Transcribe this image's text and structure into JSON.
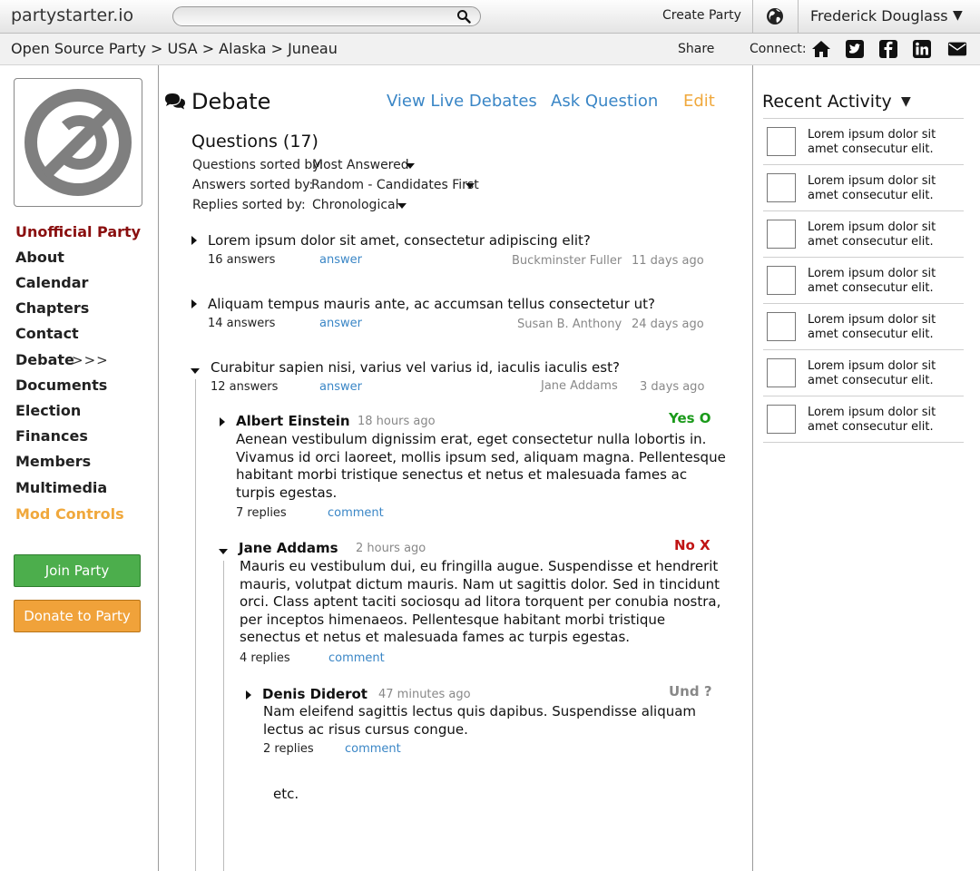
{
  "header": {
    "logo": "partystarter.io",
    "create_party": "Create Party",
    "user_name": "Frederick Douglass",
    "user_caret": "▼"
  },
  "breadcrumb": {
    "text": "Open Source Party > USA > Alaska > Juneau",
    "share": "Share",
    "connect": "Connect:"
  },
  "sidebar": {
    "items": [
      {
        "label": "Unofficial Party"
      },
      {
        "label": "About"
      },
      {
        "label": "Calendar"
      },
      {
        "label": "Chapters"
      },
      {
        "label": "Contact"
      },
      {
        "label": "Debate"
      },
      {
        "label": "Documents"
      },
      {
        "label": "Election"
      },
      {
        "label": "Finances"
      },
      {
        "label": "Members"
      },
      {
        "label": "Multimedia"
      },
      {
        "label": "Mod Controls"
      }
    ],
    "debate_arrow": ">>>",
    "join_button": "Join Party",
    "donate_button": "Donate to Party"
  },
  "main": {
    "title": "Debate",
    "view_live": "View Live Debates",
    "ask_question": "Ask Question",
    "edit": "Edit",
    "questions_heading": "Questions (17)",
    "sort": {
      "questions_label": "Questions sorted by:",
      "questions_value": "Most Answered",
      "answers_label": "Answers sorted by:",
      "answers_value": "Random - Candidates First",
      "replies_label": "Replies sorted by:",
      "replies_value": "Chronological"
    },
    "questions": [
      {
        "text": "Lorem ipsum dolor sit amet, consectetur adipiscing elit?",
        "answers": "16 answers",
        "answer_link": "answer",
        "author": "Buckminster Fuller",
        "time": "11 days ago"
      },
      {
        "text": "Aliquam tempus mauris ante, ac accumsan tellus consectetur ut?",
        "answers": "14 answers",
        "answer_link": "answer",
        "author": "Susan B. Anthony",
        "time": "24 days ago"
      },
      {
        "text": "Curabitur sapien nisi, varius vel varius id, iaculis iaculis est?",
        "answers": "12 answers",
        "answer_link": "answer",
        "author": "Jane Addams",
        "time": "3 days ago"
      }
    ],
    "answers": [
      {
        "author": "Albert Einstein",
        "time": "18 hours ago",
        "vote": "Yes O",
        "lines": [
          "Aenean vestibulum dignissim erat, eget consectetur nulla lobortis in.",
          "Vivamus id orci laoreet, mollis ipsum sed, aliquam magna. Pellentesque",
          "habitant morbi tristique senectus et netus et malesuada fames ac",
          "turpis egestas."
        ],
        "replies": "7 replies",
        "comment": "comment"
      },
      {
        "author": "Jane Addams",
        "time": "2 hours ago",
        "vote": "No X",
        "lines": [
          "Mauris eu vestibulum dui, eu fringilla augue. Suspendisse et hendrerit",
          "mauris, volutpat dictum mauris. Nam ut sagittis dolor. Sed in tincidunt",
          "orci. Class aptent taciti sociosqu ad litora torquent per conubia nostra,",
          "per inceptos himenaeos. Pellentesque habitant morbi tristique",
          "senectus et netus et malesuada fames ac turpis egestas."
        ],
        "replies": "4 replies",
        "comment": "comment"
      }
    ],
    "reply": {
      "author": "Denis Diderot",
      "time": "47 minutes ago",
      "vote": "Und ?",
      "lines": [
        "Nam eleifend sagittis lectus quis dapibus. Suspendisse aliquam",
        "lectus ac risus cursus congue."
      ],
      "replies": "2 replies",
      "comment": "comment"
    },
    "etc": "etc."
  },
  "activity": {
    "title": "Recent Activity",
    "caret": "▼",
    "items": [
      {
        "line1": "Lorem ipsum dolor sit",
        "line2": "amet consecutur elit."
      },
      {
        "line1": "Lorem ipsum dolor sit",
        "line2": "amet consecutur elit."
      },
      {
        "line1": "Lorem ipsum dolor sit",
        "line2": "amet consecutur elit."
      },
      {
        "line1": "Lorem ipsum dolor sit",
        "line2": "amet consecutur elit."
      },
      {
        "line1": "Lorem ipsum dolor sit",
        "line2": "amet consecutur elit."
      },
      {
        "line1": "Lorem ipsum dolor sit",
        "line2": "amet consecutur elit."
      },
      {
        "line1": "Lorem ipsum dolor sit",
        "line2": "amet consecutur elit."
      }
    ]
  },
  "colors": {
    "link": "#3a86c6",
    "accent_orange": "#f0a83c",
    "unofficial_red": "#8a0f0f",
    "join_green": "#4cae4c",
    "yes_green": "#1a9a1a",
    "no_red": "#c01414"
  },
  "icons": [
    "search-icon",
    "globe-icon",
    "home-icon",
    "twitter-icon",
    "facebook-icon",
    "linkedin-icon",
    "mail-icon",
    "copyleft-logo",
    "chat-bubbles-icon"
  ]
}
